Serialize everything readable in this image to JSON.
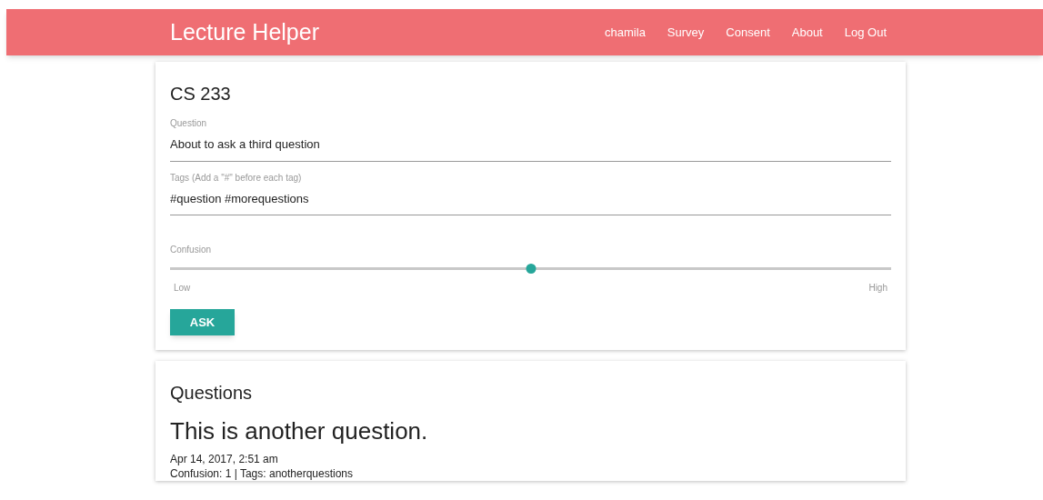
{
  "app_title": "Lecture Helper",
  "nav": [
    "chamila",
    "Survey",
    "Consent",
    "About",
    "Log Out"
  ],
  "form": {
    "course": "CS 233",
    "fields": [
      {
        "label": "Question",
        "value": "About to ask a third question"
      },
      {
        "label": "Tags (Add a \"#\" before each tag)",
        "value": "#question #morequestions"
      }
    ],
    "slider": {
      "label": "Confusion",
      "level": 0.5,
      "min_label": "Low",
      "max_label": "High"
    },
    "button": "ASK"
  },
  "questions": {
    "title": "Questions",
    "items": [
      {
        "text": "This is another question.",
        "date": "Apr 14, 2017, 2:51 am",
        "meta": "Confusion: 1 | Tags: anotherquestions"
      }
    ]
  }
}
